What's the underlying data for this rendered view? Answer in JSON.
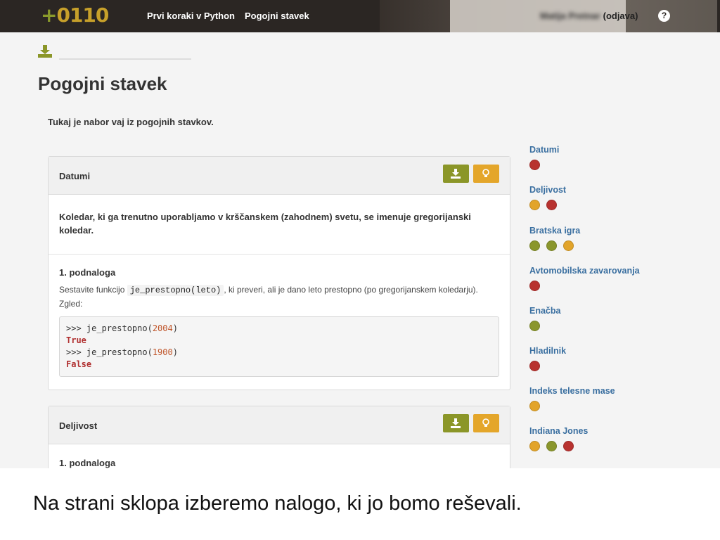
{
  "nav": {
    "logo_plus": "+",
    "logo_text": "0110",
    "course": "Prvi koraki v Python",
    "current": "Pogojni stavek",
    "user_name": "Matija Pretnar",
    "logout": "(odjava)"
  },
  "page": {
    "title": "Pogojni stavek",
    "intro": "Tukaj je nabor vaj iz pogojnih stavkov."
  },
  "problems": [
    {
      "title": "Datumi",
      "description": "Koledar, ki ga trenutno uporabljamo v krščanskem (zahodnem) svetu, se imenuje gregorijanski koledar.",
      "subtask_title": "1. podnaloga",
      "subtask_text_before": "Sestavite funkcijo ",
      "subtask_code": "je_prestopno(leto)",
      "subtask_text_after": ", ki preveri, ali je dano leto prestopno (po gregorijanskem koledarju). Zgled:",
      "example": {
        "prompt": ">>> ",
        "call1_fn": "je_prestopno(",
        "call1_arg": "2004",
        "close": ")",
        "result1": "True",
        "call2_fn": "je_prestopno(",
        "call2_arg": "1900",
        "result2": "False"
      }
    },
    {
      "title": "Deljivost",
      "subtask_title": "1. podnaloga"
    }
  ],
  "sidebar": [
    {
      "label": "Datumi",
      "dots": [
        "red"
      ]
    },
    {
      "label": "Deljivost",
      "dots": [
        "yellow",
        "red"
      ]
    },
    {
      "label": "Bratska igra",
      "dots": [
        "green",
        "green",
        "yellow"
      ]
    },
    {
      "label": "Avtomobilska zavarovanja",
      "dots": [
        "red"
      ]
    },
    {
      "label": "Enačba",
      "dots": [
        "green"
      ]
    },
    {
      "label": "Hladilnik",
      "dots": [
        "red"
      ]
    },
    {
      "label": "Indeks telesne mase",
      "dots": [
        "yellow"
      ]
    },
    {
      "label": "Indiana Jones",
      "dots": [
        "yellow",
        "green",
        "red"
      ]
    }
  ],
  "colors": {
    "red": "#b8322f",
    "yellow": "#e2a42a",
    "green": "#8a962c",
    "link": "#3a6fa0"
  },
  "caption": "Na strani sklopa izberemo nalogo, ki jo bomo reševali."
}
